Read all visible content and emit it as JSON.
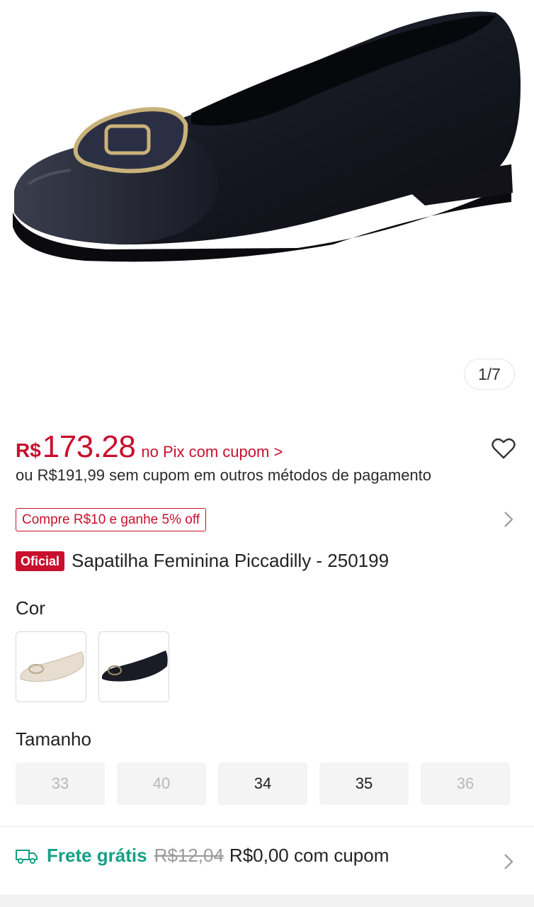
{
  "gallery": {
    "counter": "1/7"
  },
  "price": {
    "currency": "R$",
    "amount": "173.28",
    "pix_label": "no Pix com cupom >",
    "alt_text": "ou R$191,99 sem cupom em outros métodos de pagamento",
    "accent_color": "#c8102e"
  },
  "promo": {
    "label": "Compre R$10 e ganhe 5% off"
  },
  "product": {
    "badge": "Oficial",
    "title": "Sapatilha Feminina Piccadilly - 250199"
  },
  "color_section": {
    "label": "Cor",
    "options": [
      {
        "name": "cream-shoe-swatch"
      },
      {
        "name": "black-shoe-swatch"
      }
    ]
  },
  "size_section": {
    "label": "Tamanho",
    "sizes": [
      {
        "label": "33",
        "available": false
      },
      {
        "label": "40",
        "available": false
      },
      {
        "label": "34",
        "available": true
      },
      {
        "label": "35",
        "available": true
      },
      {
        "label": "36",
        "available": false
      }
    ]
  },
  "shipping": {
    "title": "Frete grátis",
    "old_price": "R$12,04",
    "new_text": "R$0,00 com cupom",
    "accent_color": "#16a085"
  }
}
